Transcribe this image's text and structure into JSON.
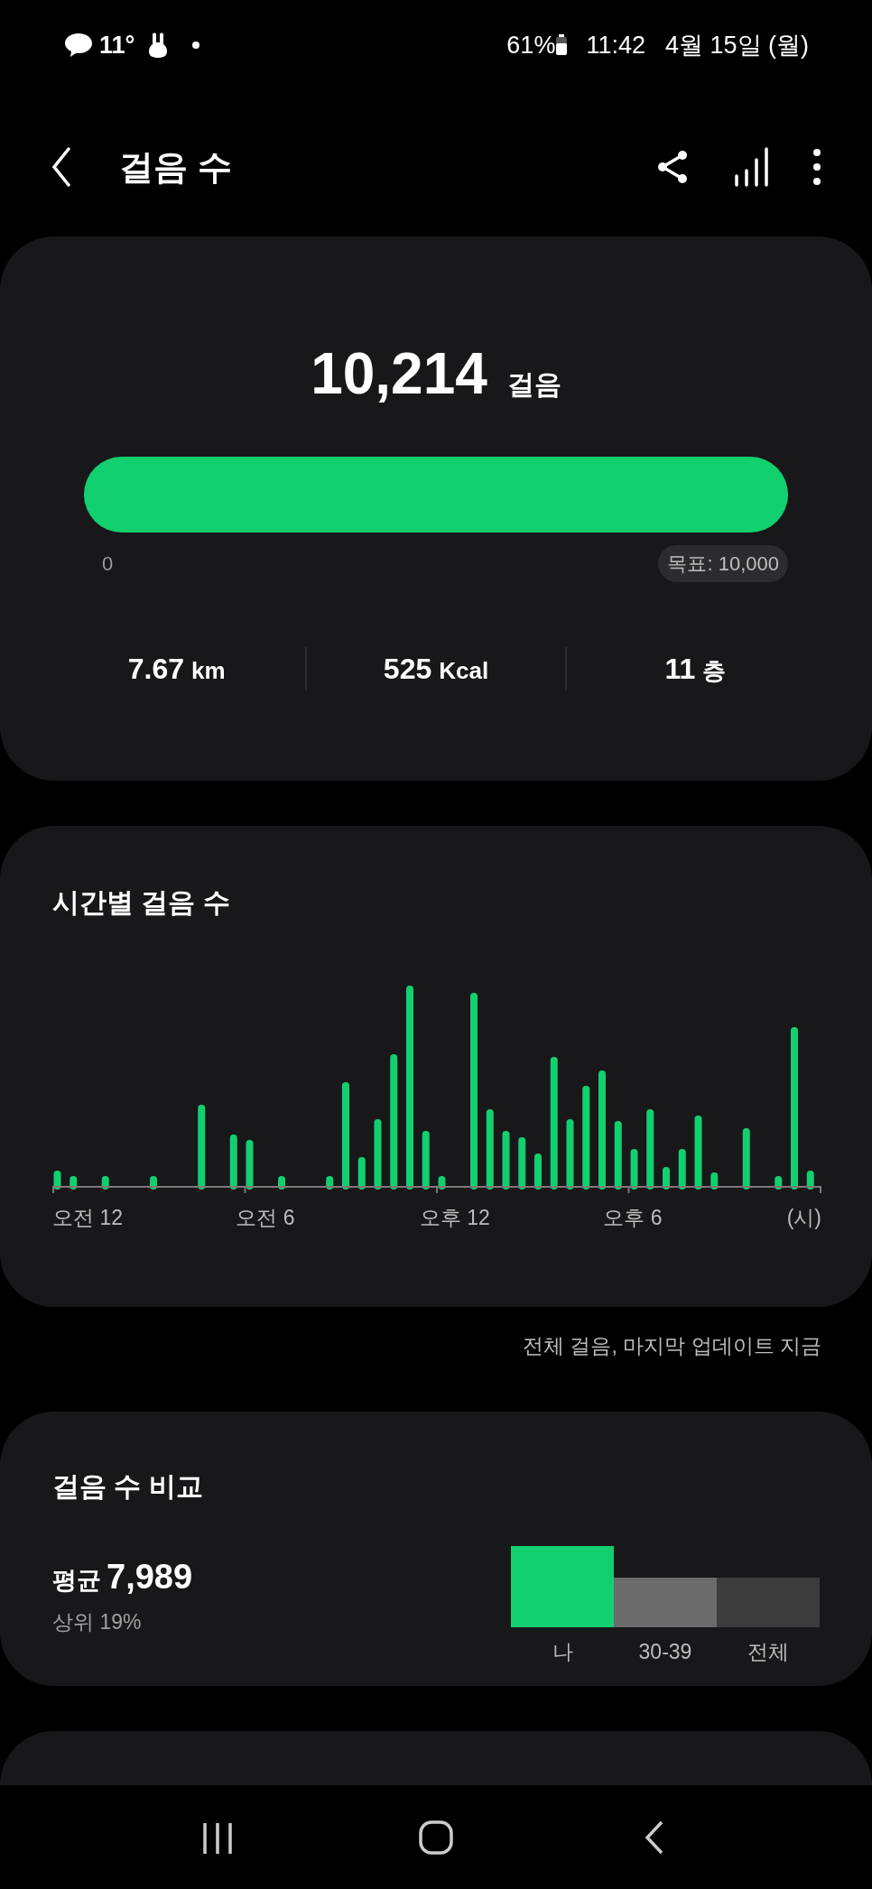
{
  "status_bar": {
    "left": [
      "11°"
    ],
    "battery": "61%",
    "time": "11:42",
    "date": "4월 15일 (월)"
  },
  "header": {
    "title": "걸음 수"
  },
  "summary": {
    "steps": "10,214",
    "steps_unit": "걸음",
    "progress": {
      "level": 1,
      "start": "0",
      "goal": "목표: 10,000"
    },
    "stats": [
      {
        "value": "7.67",
        "unit": "km"
      },
      {
        "value": "525",
        "unit": "Kcal"
      },
      {
        "value": "11",
        "unit": "층"
      }
    ]
  },
  "hourly": {
    "title": "시간별 걸음 수",
    "axis_labels": [
      "오전 12",
      "오전 6",
      "오후 12",
      "오후 6",
      "(시)"
    ]
  },
  "footnote": "전체 걸음, 마지막 업데이트 지금",
  "comparison": {
    "title": "걸음 수 비교",
    "average_label": "평균",
    "average": "7,989",
    "rank": "상위 19%",
    "groups": [
      {
        "label": "나",
        "color": "#12d06f"
      },
      {
        "label": "30-39",
        "color": "#6b6b6b"
      },
      {
        "label": "전체",
        "color": "#3c3c3c"
      }
    ]
  }
}
